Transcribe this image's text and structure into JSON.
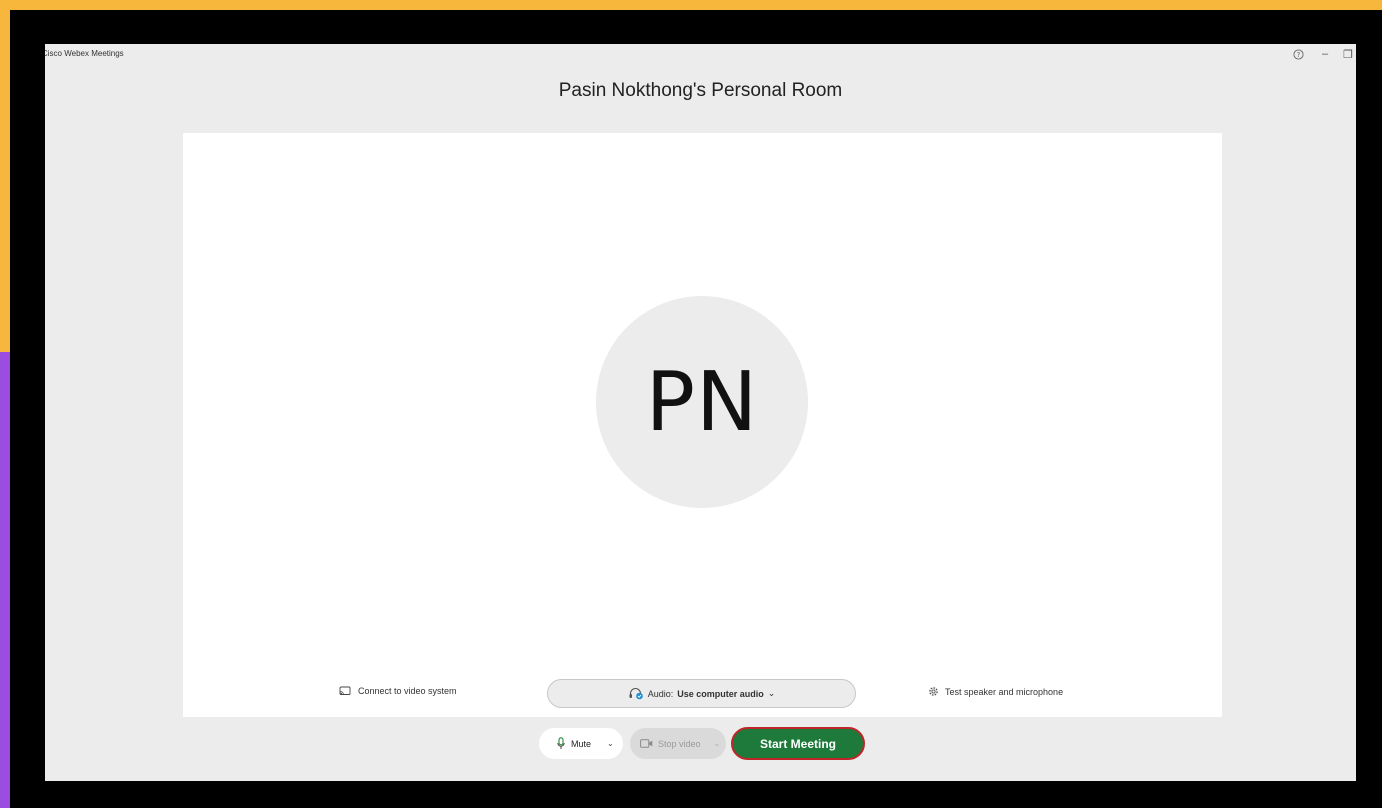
{
  "window": {
    "app_title": "Cisco Webex Meetings",
    "controls": {
      "help": "?",
      "minimize": "–",
      "restore": "❐"
    }
  },
  "room": {
    "title": "Pasin Nokthong's Personal Room",
    "avatar_initials": "PN"
  },
  "options": {
    "connect_video_label": "Connect to video system",
    "audio_prefix": "Audio:",
    "audio_value": "Use computer audio",
    "audio_chevron": "⌄",
    "test_speaker_label": "Test speaker and microphone"
  },
  "controls": {
    "mute_label": "Mute",
    "mute_chevron": "⌄",
    "stop_video_label": "Stop video",
    "video_chevron": "⌄",
    "start_label": "Start Meeting"
  },
  "colors": {
    "start_button": "#1d7a3a",
    "start_border": "#c0252a",
    "background": "#ececec",
    "frame_yellow": "#f6b73c",
    "frame_purple": "#9b4de0"
  }
}
